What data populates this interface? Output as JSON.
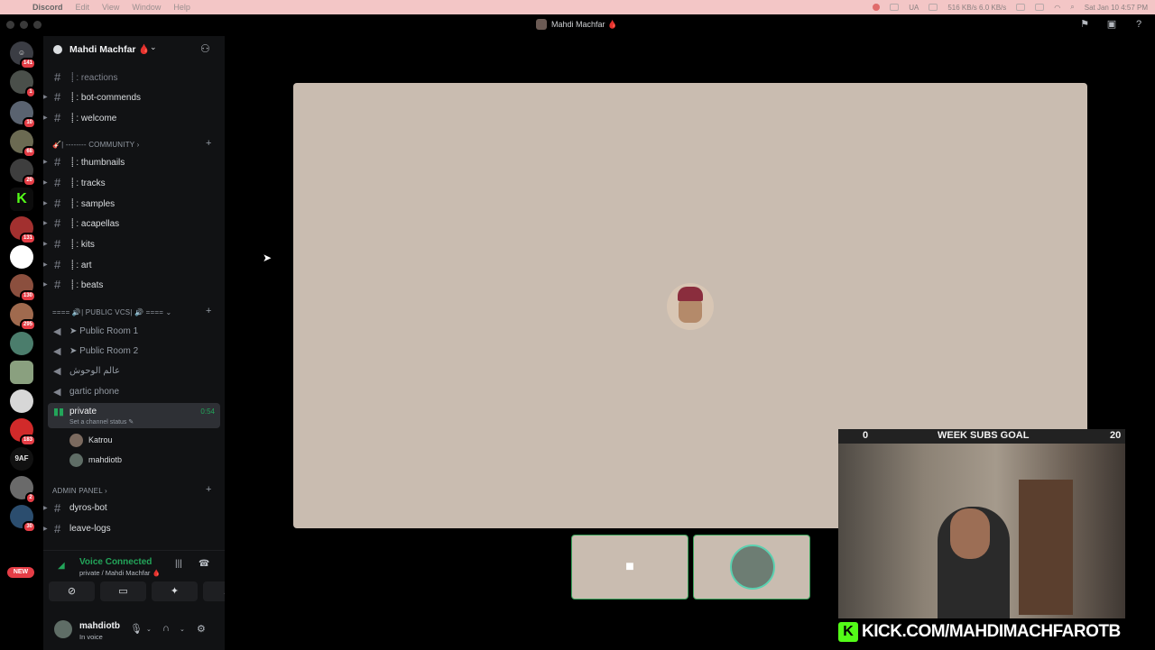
{
  "menubar": {
    "app": "Discord",
    "items": [
      "Edit",
      "View",
      "Window",
      "Help"
    ],
    "network": "516 KB/s 6.0 KB/s",
    "clock": "Sat Jan 10  4:57 PM",
    "lang": "UA"
  },
  "window": {
    "title": "Mahdi Machfar 🩸"
  },
  "rail": {
    "servers": [
      {
        "badge": "141"
      },
      {
        "badge": "1"
      },
      {
        "badge": "10"
      },
      {
        "badge": "68"
      },
      {
        "badge": "20"
      },
      {
        "badge": ""
      },
      {
        "badge": "131"
      },
      {
        "badge": ""
      },
      {
        "badge": "130"
      },
      {
        "badge": "295"
      },
      {
        "badge": ""
      },
      {
        "badge": ""
      },
      {
        "badge": ""
      },
      {
        "badge": "183"
      },
      {
        "text": "9AF",
        "badge": ""
      },
      {
        "badge": "2"
      },
      {
        "badge": "30"
      }
    ],
    "new_label": "NEW"
  },
  "guild": {
    "name": "Mahdi Machfar 🩸"
  },
  "channels_top": [
    {
      "label": "⸽ : reactions",
      "muted": true
    },
    {
      "label": "⸽ : bot-commends"
    },
    {
      "label": "⸽ : welcome"
    }
  ],
  "cat_community": "🎸| -------- COMMUNITY ›",
  "channels_community": [
    {
      "label": "⸽ : thumbnails"
    },
    {
      "label": "⸽ : tracks"
    },
    {
      "label": "⸽ : samples"
    },
    {
      "label": "⸽ : acapellas"
    },
    {
      "label": "⸽ : kits"
    },
    {
      "label": "⸽ : art"
    },
    {
      "label": "⸽ : beats"
    }
  ],
  "cat_public": "==== 🔊| PUBLIC VCs| 🔊 ==== ⌄",
  "voice_channels": [
    {
      "label": "➤ Public Room 1"
    },
    {
      "label": "➤ Public Room 2"
    },
    {
      "label": "عالم الوحوش"
    },
    {
      "label": "gartic phone"
    }
  ],
  "active_voice": {
    "label": "private",
    "timer": "0:54",
    "status": "Set a channel status ✎",
    "users": [
      "Katrou",
      "mahdiotb"
    ]
  },
  "cat_admin": "ADMIN PANEL ›",
  "channels_admin": [
    {
      "label": "dyros-bot"
    },
    {
      "label": "leave-logs"
    }
  ],
  "voice_panel": {
    "title": "Voice Connected",
    "subtitle": "private / Mahdi Machfar 🩸"
  },
  "user": {
    "name": "mahdiotb",
    "status": "In voice"
  },
  "goal": {
    "current": "0",
    "title": "WEEK SUBS GOAL",
    "target": "20",
    "progress": 0
  },
  "kick_url": "KICK.COM/MAHDIMACHFAROTB",
  "colors": {
    "accent_green": "#23a55a",
    "kick_green": "#53fc18",
    "badge_red": "#e53d46",
    "stage_bg": "#c9bcb0"
  }
}
